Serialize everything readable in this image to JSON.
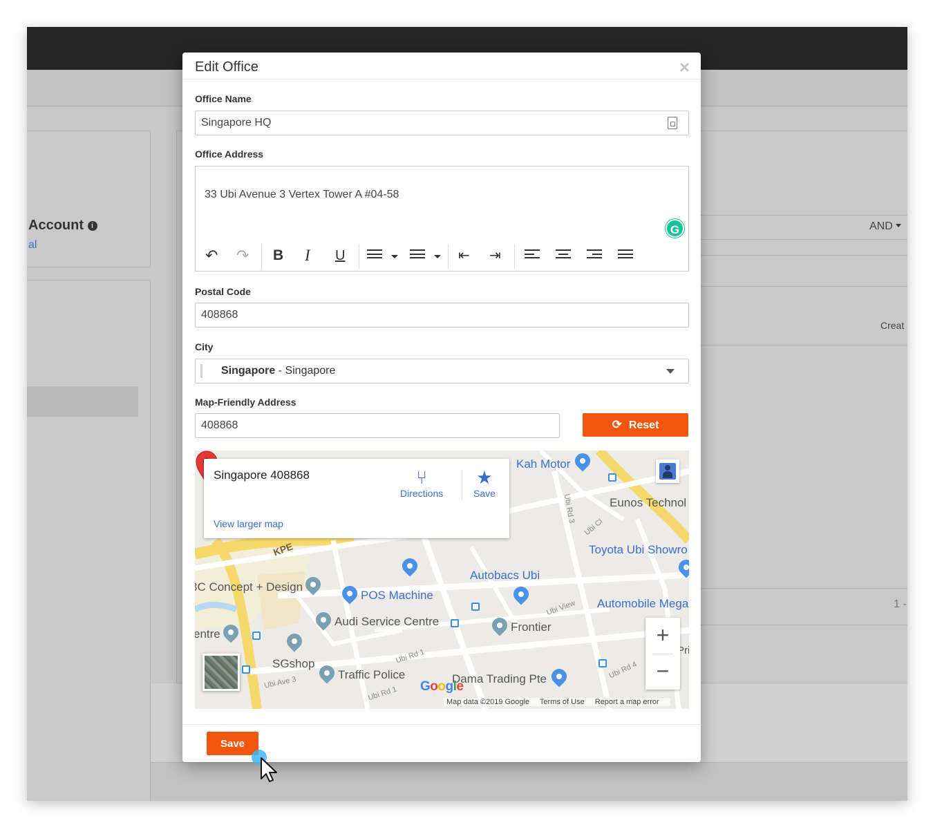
{
  "background": {
    "account_title": "Account",
    "account_sub": "al",
    "and_dropdown": "AND",
    "create_label": "Creat",
    "pager": "1 -"
  },
  "modal": {
    "title": "Edit Office",
    "close_glyph": "×",
    "office_name": {
      "label": "Office Name",
      "value": "Singapore HQ"
    },
    "office_address": {
      "label": "Office Address",
      "value": "33 Ubi Avenue 3 Vertex Tower A #04-58",
      "grammarly": "G"
    },
    "toolbar": {
      "undo": "↶",
      "redo": "↷",
      "bold": "B",
      "italic": "I",
      "underline": "U",
      "outdent": "⇤",
      "indent": "⇥"
    },
    "postal_code": {
      "label": "Postal Code",
      "value": "408868"
    },
    "city": {
      "label": "City",
      "value_bold": "Singapore",
      "value_rest": " - Singapore"
    },
    "map_address": {
      "label": "Map-Friendly Address",
      "value": "408868",
      "reset_label": "Reset",
      "reset_icon": "⟳"
    },
    "map": {
      "card_title": "Singapore 408868",
      "directions": "Directions",
      "save": "Save",
      "view_larger": "View larger map",
      "places": {
        "kah_motor": "Kah Motor",
        "eunos": "Eunos Technol",
        "toyota": "Toyota Ubi Showro",
        "autobacs": "Autobacs Ubi",
        "automobile": "Automobile Mega",
        "concept": "3C Concept + Design",
        "pos": "POS Machine",
        "audi": "Audi Service Centre",
        "frontier": "Frontier",
        "sgshop": "SGshop",
        "traffic": "Traffic Police",
        "dama": "Dama Trading Pte",
        "centre": "entre",
        "kpe": "KPE",
        "pri": "Pri"
      },
      "roads": {
        "ubi_rd3": "Ubi Rd 3",
        "ubi_cl": "Ubi Cl",
        "ubi_view": "Ubi View",
        "ubi_rd1a": "Ubi Rd 1",
        "ubi_rd1b": "Ubi Rd 1",
        "ubi_ave3": "Ubi Ave 3",
        "ubi_rd4": "Ubi Rd 4"
      },
      "google": "Google",
      "attribution": {
        "data": "Map data ©2019 Google",
        "terms": "Terms of Use",
        "report": "Report a map error"
      },
      "zoom_in": "+",
      "zoom_out": "−"
    },
    "save_label": "Save"
  },
  "colors": {
    "accent": "#f2560e",
    "link": "#3a6fcc",
    "pin_red": "#e53935",
    "grammarly": "#15c39a"
  }
}
